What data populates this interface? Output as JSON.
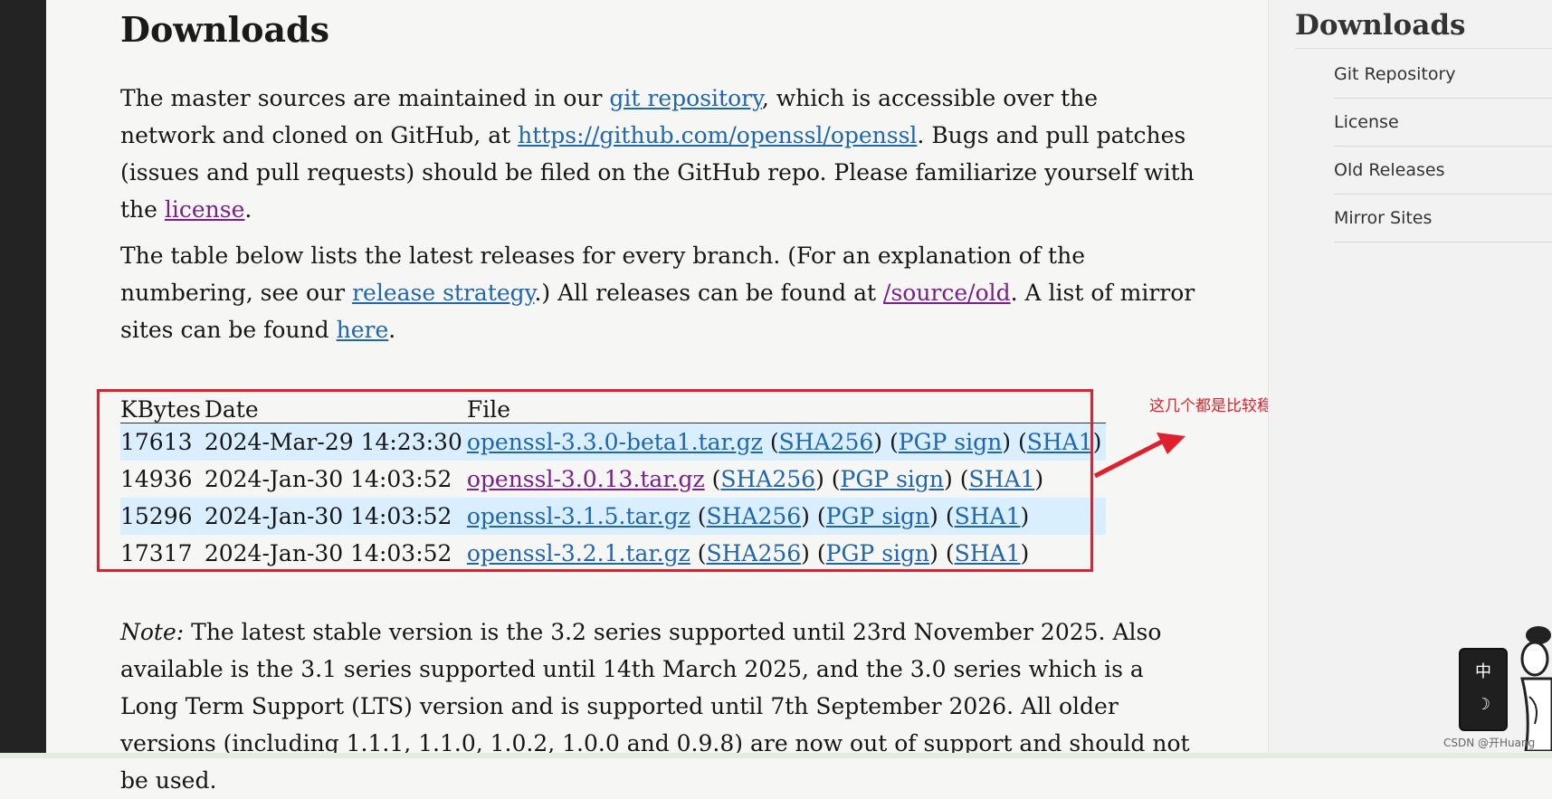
{
  "main": {
    "title": "Downloads",
    "para1": {
      "t1": "The master sources are maintained in our ",
      "link_git": "git repository",
      "t2": ", which is accessible over the network and cloned on GitHub, at ",
      "link_github": "https://github.com/openssl/openssl",
      "t3": ". Bugs and pull patches (issues and pull requests) should be filed on the GitHub repo. Please familiarize yourself with the ",
      "link_license": "license",
      "t4": "."
    },
    "para2": {
      "t1": "The table below lists the latest releases for every branch. (For an explanation of the numbering, see our ",
      "link_strategy": "release strategy",
      "t2": ".) All releases can be found at ",
      "link_old": "/source/old",
      "t3": ". A list of mirror sites can be found ",
      "link_here": "here",
      "t4": "."
    },
    "table": {
      "headers": [
        "KBytes",
        "Date",
        "File"
      ],
      "rows": [
        {
          "kbytes": "17613",
          "date": "2024-Mar-29 14:23:30",
          "file": "openssl-3.3.0-beta1.tar.gz"
        },
        {
          "kbytes": "14936",
          "date": "2024-Jan-30 14:03:52",
          "file": "openssl-3.0.13.tar.gz"
        },
        {
          "kbytes": "15296",
          "date": "2024-Jan-30 14:03:52",
          "file": "openssl-3.1.5.tar.gz"
        },
        {
          "kbytes": "17317",
          "date": "2024-Jan-30 14:03:52",
          "file": "openssl-3.2.1.tar.gz"
        }
      ],
      "sha256": "SHA256",
      "pgp": "PGP sign",
      "sha1": "SHA1",
      "open_paren": "(",
      "close_paren": ")",
      "sep": ") ("
    },
    "note": {
      "label": "Note:",
      "text": " The latest stable version is the 3.2 series supported until 23rd November 2025. Also available is the 3.1 series supported until 14th March 2025, and the 3.0 series which is a Long Term Support (LTS) version and is supported until 7th September 2026. All older versions (including 1.1.1, 1.1.0, 1.0.2, 1.0.0 and 0.9.8) are now out of support and should not be used."
    }
  },
  "sidebar": {
    "title": "Downloads",
    "items": [
      "Git Repository",
      "License",
      "Old Releases",
      "Mirror Sites"
    ]
  },
  "annotation": {
    "text": "这几个都是比较稳定的并且是长期维护的版本",
    "color": "#e0202c"
  },
  "ime": {
    "lang": "中",
    "mode": "☽"
  },
  "watermark": "CSDN @开Huang",
  "colors": {
    "link": "#1f66b0",
    "visited_link": "#7a1f8c",
    "row_highlight": "#d9efff"
  }
}
